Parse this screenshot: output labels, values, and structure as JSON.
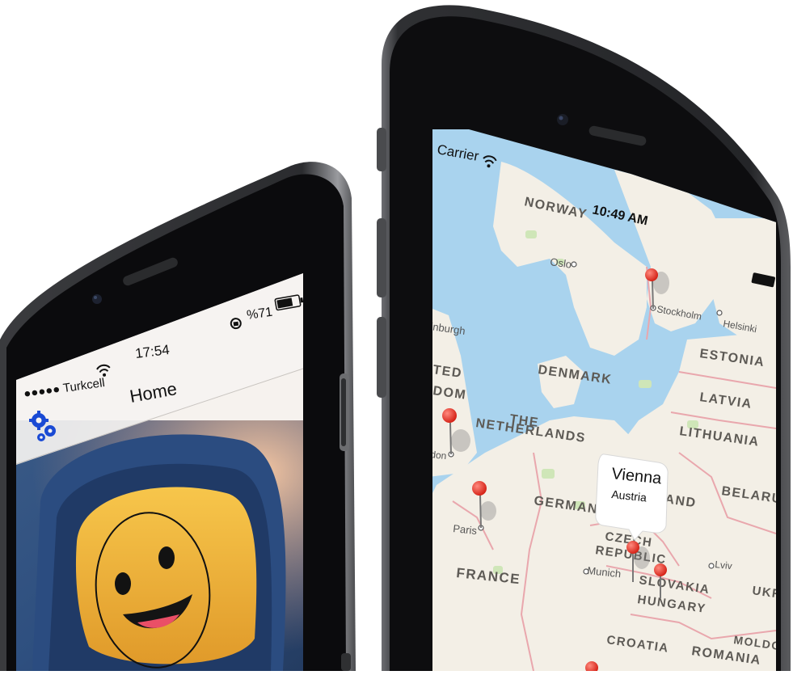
{
  "left_phone": {
    "status_bar": {
      "carrier": "●●●●● Turkcell",
      "time": "17:54",
      "battery_text": "%71",
      "battery_level": 0.71
    },
    "nav_bar": {
      "title": "Home",
      "settings_icon": "gears-icon"
    },
    "content": {
      "image_subject": "lego-spaceman-face-photo",
      "overlay": "face-detection-circle"
    }
  },
  "right_phone": {
    "status_bar": {
      "carrier": "Carrier",
      "time": "10:49 AM",
      "battery_level": 1.0
    },
    "map": {
      "country_labels": [
        "NORWAY",
        "ESTONIA",
        "DENMARK",
        "LATVIA",
        "THE",
        "NETHERLANDS",
        "LITHUANIA",
        "TED",
        "DOM",
        "GERMANY",
        "BELARUS",
        "AND",
        "CZECH",
        "REPUBLIC",
        "FRANCE",
        "SLOVAKIA",
        "HUNGARY",
        "UKRA",
        "CROATIA",
        "ROMANIA",
        "MOLDOVA"
      ],
      "city_labels": [
        "Oslo",
        "Stockholm",
        "Helsinki",
        "inburgh",
        "Paris",
        "Munich",
        "Lviv",
        "don"
      ],
      "callout": {
        "title": "Vienna",
        "subtitle": "Austria"
      },
      "colors": {
        "water": "#a9d3ee",
        "land": "#f3efe6",
        "pin": "#e8271b",
        "border": "#e9a7ad"
      }
    }
  }
}
